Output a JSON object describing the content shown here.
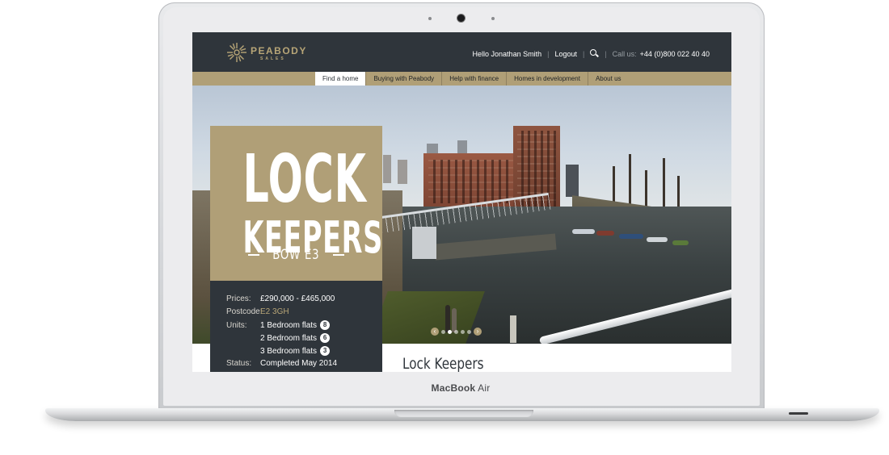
{
  "device": {
    "brand_main": "MacBook",
    "brand_sub": "Air"
  },
  "site": {
    "logo": {
      "name": "PEABODY",
      "sub": "SALES"
    },
    "utility": {
      "greeting": "Hello Jonathan Smith",
      "logout": "Logout",
      "call_label": "Call us:",
      "phone": "+44 (0)800 022 40 40"
    },
    "nav": [
      {
        "label": "Find a home",
        "active": true
      },
      {
        "label": "Buying with Peabody"
      },
      {
        "label": "Help with finance"
      },
      {
        "label": "Homes in development"
      },
      {
        "label": "About us"
      }
    ],
    "hero": {
      "title_line1": "LOCK",
      "title_line2": "KEEPERS",
      "location": "BOW E3",
      "slider": {
        "prev": "‹",
        "next": "›",
        "total_dots": 5,
        "active_dot": 1
      }
    },
    "details": {
      "prices_label": "Prices:",
      "prices": "£290,000 - £465,000",
      "postcode_label": "Postcode:",
      "postcode": "E2 3GH",
      "units_label": "Units:",
      "units": [
        {
          "label": "1 Bedroom flats",
          "count": "8"
        },
        {
          "label": "2 Bedroom flats",
          "count": "6"
        },
        {
          "label": "3 Bedroom flats",
          "count": "3"
        }
      ],
      "status_label": "Status:",
      "status": "Completed May 2014"
    },
    "page_heading": "Lock Keepers"
  },
  "colors": {
    "gold": "#b09f77",
    "dark": "#2f353b",
    "white": "#ffffff"
  }
}
